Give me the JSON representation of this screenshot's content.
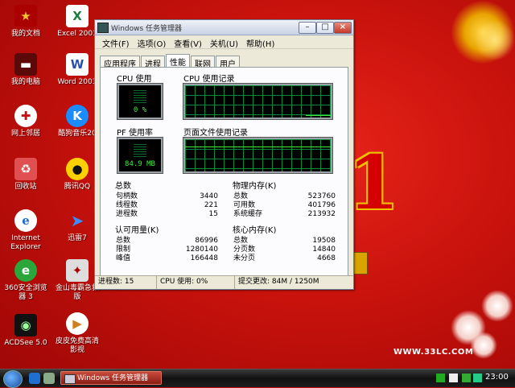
{
  "desktop": {
    "icons": [
      {
        "label": "我的文档",
        "glyph": "★",
        "color": "#f4c430",
        "icon": "my-documents-icon"
      },
      {
        "label": "我的电脑",
        "glyph": "▬",
        "color": "#7a0c0c",
        "icon": "my-computer-icon"
      },
      {
        "label": "网上邻居",
        "glyph": "✚",
        "color": "#c81010",
        "icon": "network-icon"
      },
      {
        "label": "回收站",
        "glyph": "♻",
        "color": "#c81010",
        "icon": "recycle-bin-icon"
      },
      {
        "label": "Internet\nExplorer",
        "glyph": "e",
        "color": "#1e6fd0",
        "icon": "ie-icon"
      },
      {
        "label": "360安全浏览\n器 3",
        "glyph": "e",
        "color": "#2aa63a",
        "icon": "browser-360-icon"
      },
      {
        "label": "ACDSee 5.0",
        "glyph": "◉",
        "color": "#222",
        "icon": "acdsee-icon"
      },
      {
        "label": "Excel 2003",
        "glyph": "X",
        "color": "#1e7d3a",
        "icon": "excel-icon"
      },
      {
        "label": "Word 2003",
        "glyph": "W",
        "color": "#2a4fb0",
        "icon": "word-icon"
      },
      {
        "label": "酷狗音乐20",
        "glyph": "K",
        "color": "#1a8cff",
        "icon": "kugou-icon"
      },
      {
        "label": "腾讯QQ",
        "glyph": "●",
        "color": "#222",
        "icon": "qq-icon"
      },
      {
        "label": "迅雷7",
        "glyph": "➤",
        "color": "#1a6fd0",
        "icon": "thunder-icon"
      },
      {
        "label": "金山毒霸急救\n版",
        "glyph": "✦",
        "color": "#8a8a8a",
        "icon": "kingsoft-icon"
      },
      {
        "label": "皮皮免费高清\n影视",
        "glyph": "▶",
        "color": "#d08020",
        "icon": "pipi-icon"
      }
    ],
    "big_digit": "1",
    "site_text": "WWW.33LC.COM"
  },
  "window": {
    "title": "Windows 任务管理器",
    "menu": [
      "文件(F)",
      "选项(O)",
      "查看(V)",
      "关机(U)",
      "帮助(H)"
    ],
    "tabs": [
      "应用程序",
      "进程",
      "性能",
      "联网",
      "用户"
    ],
    "active_tab": "性能",
    "cpu_usage_label": "CPU 使用",
    "cpu_usage_value": "0 %",
    "cpu_usage_fraction": 0.0,
    "cpu_history_label": "CPU 使用记录",
    "pf_label": "PF 使用率",
    "pf_value": "84.9 MB",
    "pf_history_label": "页面文件使用记录",
    "totals": {
      "head": "总数",
      "rows": [
        {
          "k": "句柄数",
          "v": "3440"
        },
        {
          "k": "线程数",
          "v": "221"
        },
        {
          "k": "进程数",
          "v": "15"
        }
      ]
    },
    "physical": {
      "head": "物理内存(K)",
      "rows": [
        {
          "k": "总数",
          "v": "523760"
        },
        {
          "k": "可用数",
          "v": "401796"
        },
        {
          "k": "系统缓存",
          "v": "213932"
        }
      ]
    },
    "commit": {
      "head": "认可用量(K)",
      "rows": [
        {
          "k": "总数",
          "v": "86996"
        },
        {
          "k": "限制",
          "v": "1280140"
        },
        {
          "k": "峰值",
          "v": "166448"
        }
      ]
    },
    "kernel": {
      "head": "核心内存(K)",
      "rows": [
        {
          "k": "总数",
          "v": "19508"
        },
        {
          "k": "分页数",
          "v": "14840"
        },
        {
          "k": "未分页",
          "v": "4668"
        }
      ]
    },
    "status": {
      "processes": "进程数: 15",
      "cpu": "CPU 使用: 0%",
      "commit": "提交更改: 84M / 1250M"
    }
  },
  "taskbar": {
    "item": "Windows 任务管理器",
    "clock": "23:00"
  }
}
